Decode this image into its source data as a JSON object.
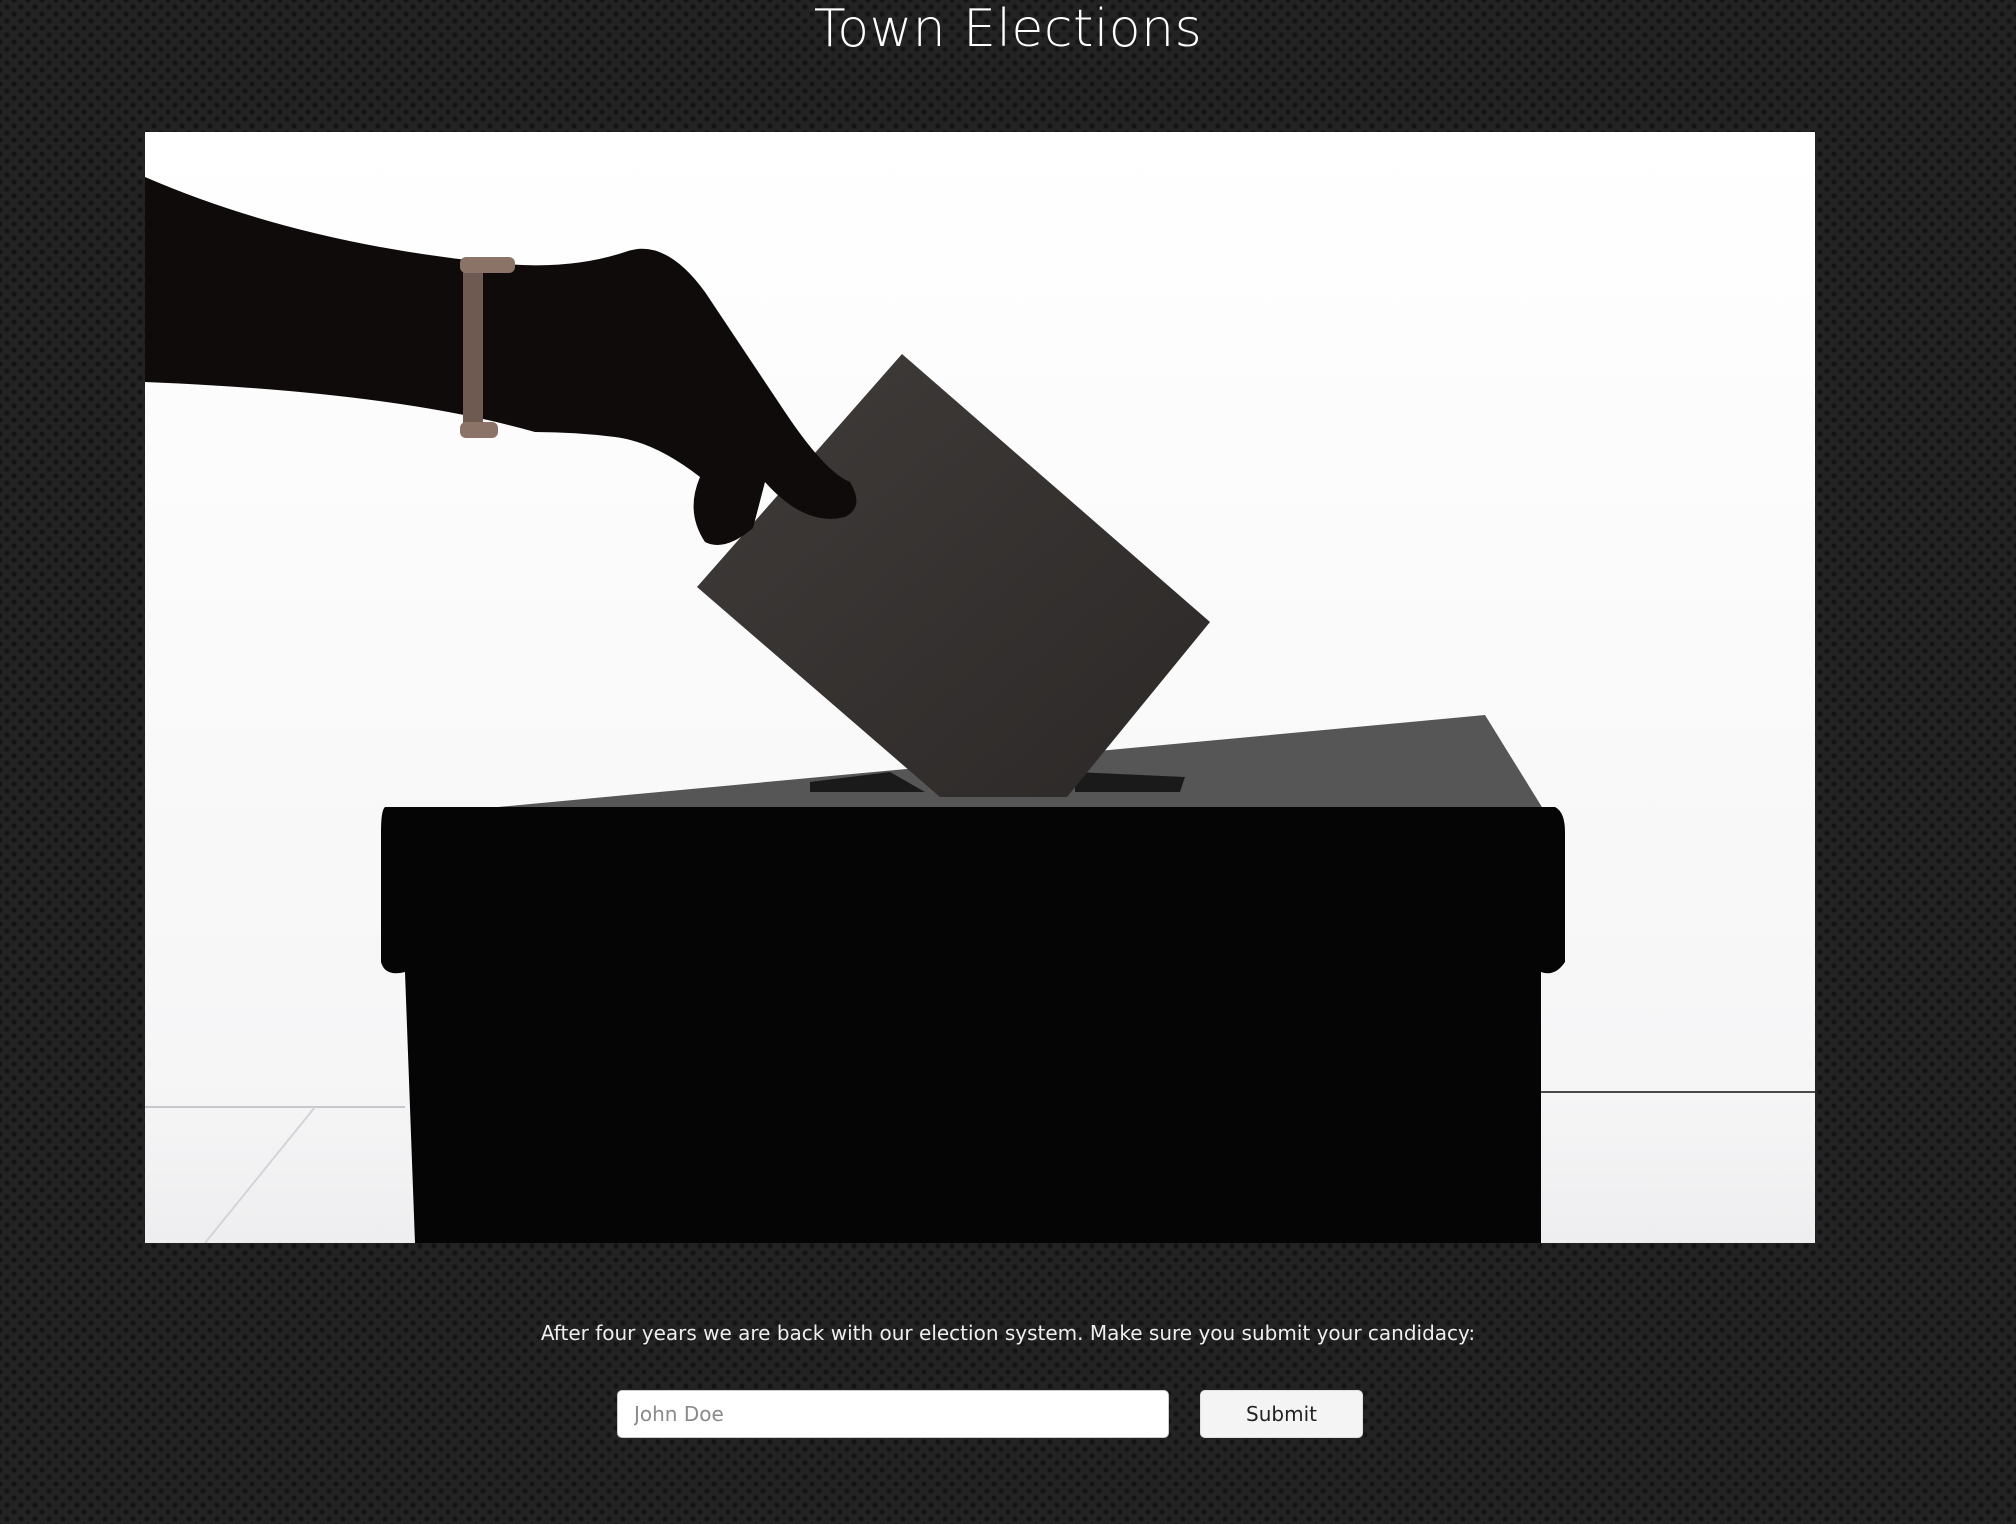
{
  "page": {
    "title": "Town Elections",
    "intro_text": "After four years we are back with our election system. Make sure you submit your candidacy:"
  },
  "hero_image": {
    "subject": "silhouette of a hand dropping a ballot into a ballot box"
  },
  "form": {
    "name_input_placeholder": "John Doe",
    "name_input_value": "",
    "submit_label": "Submit"
  },
  "colors": {
    "background": "#232323",
    "text": "#ffffff",
    "input_background": "#ffffff",
    "button_background": "#f4f4f4"
  }
}
